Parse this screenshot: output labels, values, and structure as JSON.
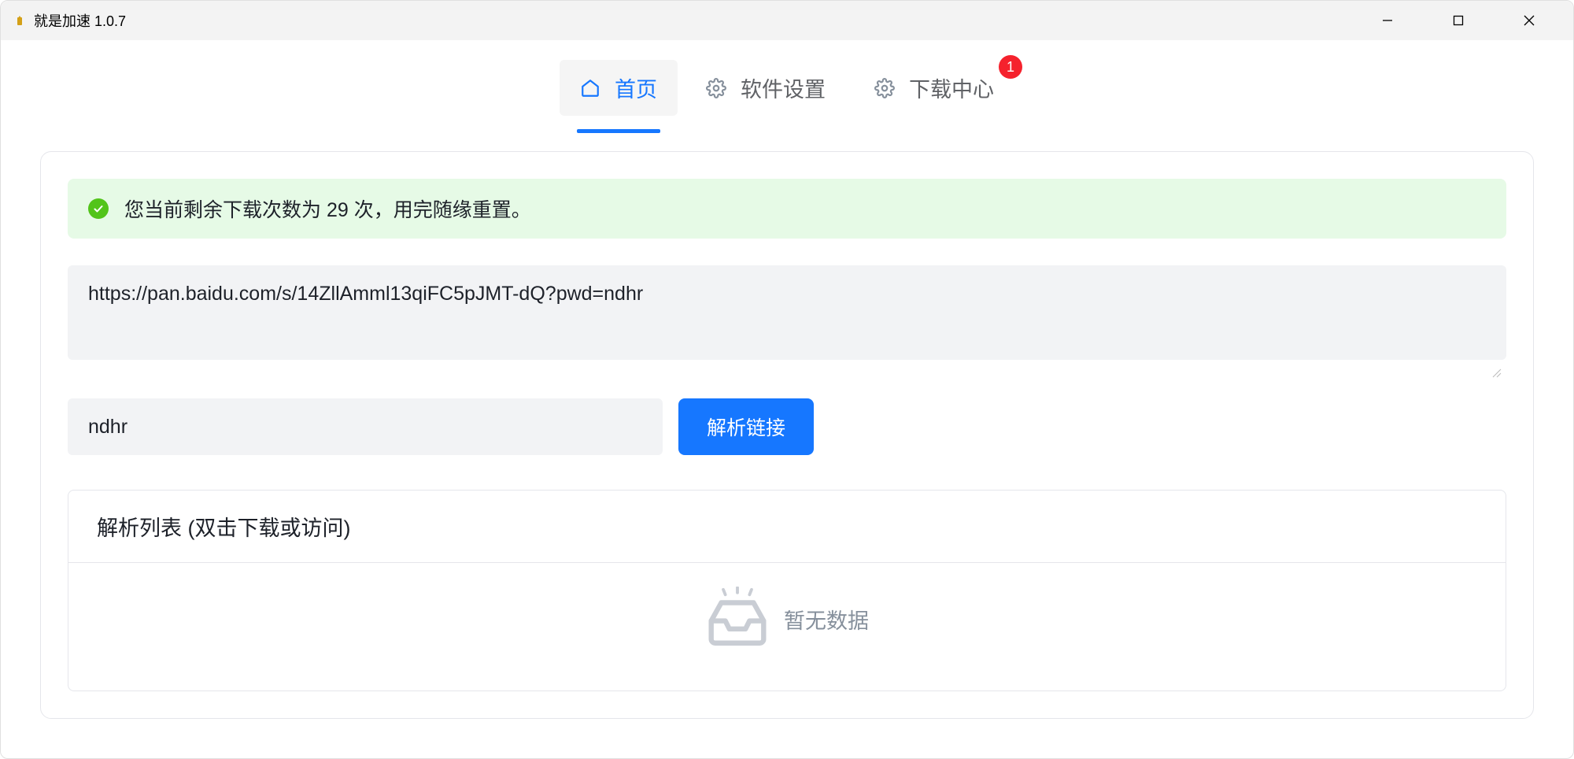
{
  "window": {
    "title": "就是加速  1.0.7"
  },
  "tabs": {
    "home": {
      "label": "首页"
    },
    "settings": {
      "label": "软件设置"
    },
    "downloads": {
      "label": "下载中心",
      "badge": "1"
    }
  },
  "alert": {
    "text": "您当前剩余下载次数为 29 次，用完随缘重置。"
  },
  "inputs": {
    "url_value": "https://pan.baidu.com/s/14ZllAmml13qiFC5pJMT-dQ?pwd=ndhr",
    "pwd_value": "ndhr"
  },
  "buttons": {
    "parse": "解析链接"
  },
  "parse_list": {
    "header": "解析列表 (双击下载或访问)",
    "empty": "暂无数据"
  }
}
